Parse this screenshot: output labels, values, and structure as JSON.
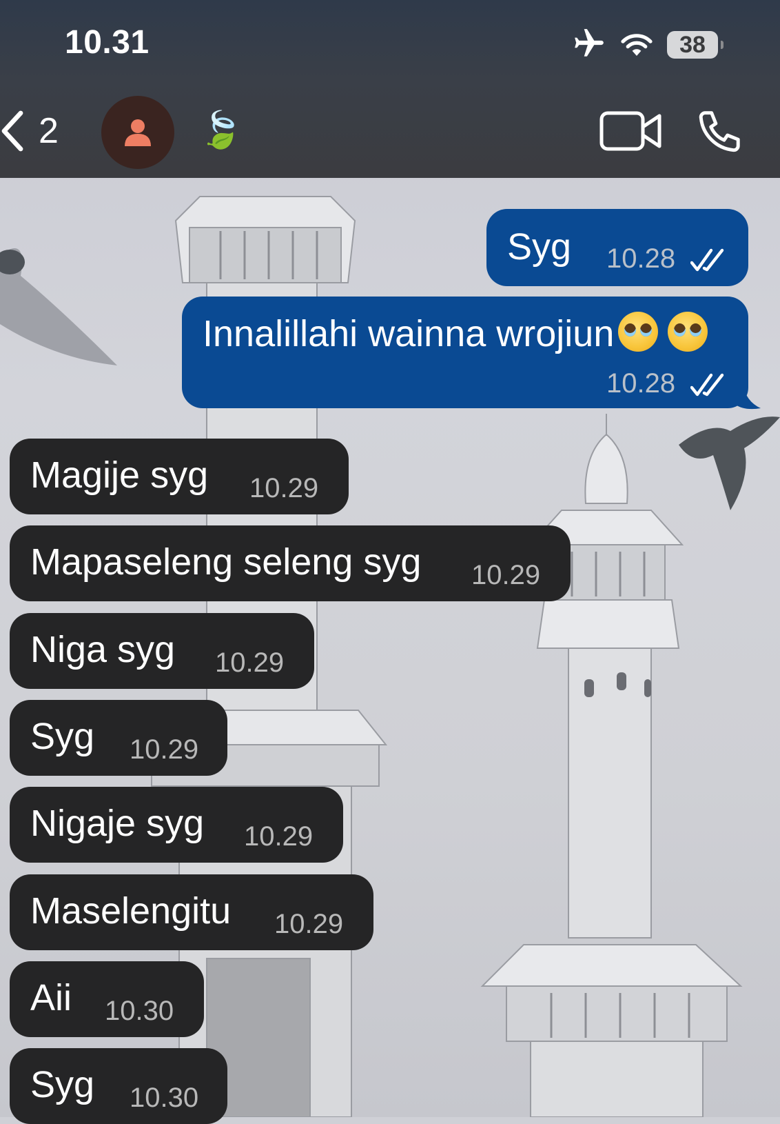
{
  "status_bar": {
    "time": "10.31",
    "battery": "38",
    "icons": [
      "airplane-icon",
      "wifi-icon",
      "battery-icon"
    ]
  },
  "header": {
    "back_count": "2",
    "contact_emoji": "🍃",
    "avatar_icon": "person-icon",
    "actions": [
      "video-call-icon",
      "phone-call-icon"
    ]
  },
  "colors": {
    "outgoing_bubble": "#0a4a93",
    "incoming_bubble": "#252526",
    "header_bg": "#3b3c40"
  },
  "messages": [
    {
      "direction": "outgoing",
      "text": "Syg",
      "time": "10.28",
      "status": "read"
    },
    {
      "direction": "outgoing",
      "text": "Innalillahi wainna wrojiun",
      "emoji": "🥹🥹",
      "time": "10.28",
      "status": "read"
    },
    {
      "direction": "incoming",
      "text": "Magije syg",
      "time": "10.29"
    },
    {
      "direction": "incoming",
      "text": "Mapaseleng seleng syg",
      "time": "10.29"
    },
    {
      "direction": "incoming",
      "text": "Niga syg",
      "time": "10.29"
    },
    {
      "direction": "incoming",
      "text": "Syg",
      "time": "10.29"
    },
    {
      "direction": "incoming",
      "text": "Nigaje syg",
      "time": "10.29"
    },
    {
      "direction": "incoming",
      "text": "Maselengitu",
      "time": "10.29"
    },
    {
      "direction": "incoming",
      "text": "Aii",
      "time": "10.30"
    },
    {
      "direction": "incoming",
      "text": "Syg",
      "time": "10.30"
    }
  ]
}
